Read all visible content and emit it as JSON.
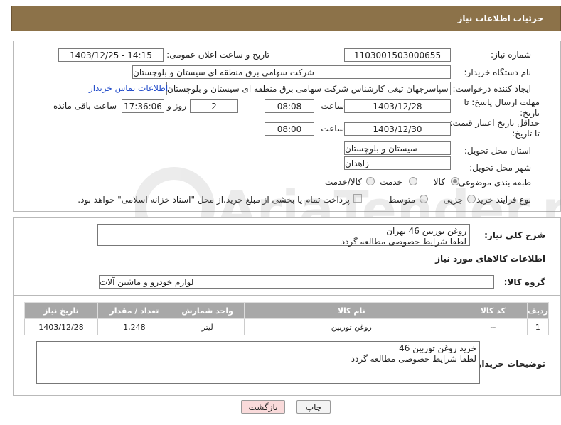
{
  "header": {
    "title": "جزئیات اطلاعات نیاز"
  },
  "form": {
    "need_number_label": "شماره نیاز:",
    "need_number": "1103001503000655",
    "announce_label": "تاریخ و ساعت اعلان عمومی:",
    "announce_value": "1403/12/25 - 14:15",
    "buyer_org_label": "نام دستگاه خریدار:",
    "buyer_org": "شرکت سهامی برق منطقه ای سیستان و بلوچستان",
    "creator_label": "ایجاد کننده درخواست:",
    "creator": "علی سپاسرجهان تیغی کارشناس شرکت سهامی برق منطقه ای سیستان و بلوچستان",
    "contact_link": "اطلاعات تماس خریدار",
    "deadline_label": "مهلت ارسال پاسخ: تا تاریخ:",
    "deadline_date": "1403/12/28",
    "time_label": "ساعت",
    "deadline_time": "08:08",
    "days_value": "2",
    "days_label": "روز و",
    "remaining_time": "17:36:06",
    "remaining_label": "ساعت باقی مانده",
    "validity_label": "حداقل تاریخ اعتبار قیمت: تا تاریخ:",
    "validity_date": "1403/12/30",
    "validity_time": "08:00",
    "province_label": "استان محل تحویل:",
    "province": "سیستان و بلوچستان",
    "city_label": "شهر محل تحویل:",
    "city": "زاهدان",
    "category_label": "طبقه بندی موضوعی:",
    "category_options": [
      "کالا",
      "خدمت",
      "کالا/خدمت"
    ],
    "process_label": "نوع فرآیند خرید :",
    "process_options": [
      "جزیی",
      "متوسط"
    ],
    "payment_note": "پرداخت تمام یا بخشی از مبلغ خرید،از محل \"اسناد خزانه اسلامی\" خواهد بود."
  },
  "description": {
    "label": "شرح کلی نیاز:",
    "line1": "روغن توربین 46  بهران",
    "line2": "لطفا شرایط خصوصی مطالعه گردد"
  },
  "goods": {
    "section_title": "اطلاعات کالاهای مورد نیاز",
    "group_label": "گروه کالا:",
    "group_value": "لوازم خودرو و ماشین آلات",
    "columns": [
      "ردیف",
      "کد کالا",
      "نام کالا",
      "واحد شمارش",
      "تعداد / مقدار",
      "تاریخ نیاز"
    ],
    "rows": [
      [
        "1",
        "--",
        "روغن توربین",
        "لیتر",
        "1,248",
        "1403/12/28"
      ]
    ]
  },
  "buyer_notes": {
    "label": "توضیحات خریدار:",
    "line1": "خرید روغن توربین  46",
    "line2": "لطفا شرایط خصوصی مطالعه گردد"
  },
  "buttons": {
    "print": "چاپ",
    "back": "بازگشت"
  },
  "watermark": {
    "text": "AriaTender.neT"
  },
  "colors": {
    "header": "#8c7249",
    "table_header": "#a8a8a8",
    "link": "#1f49c8",
    "back_button": "#f9dada"
  }
}
